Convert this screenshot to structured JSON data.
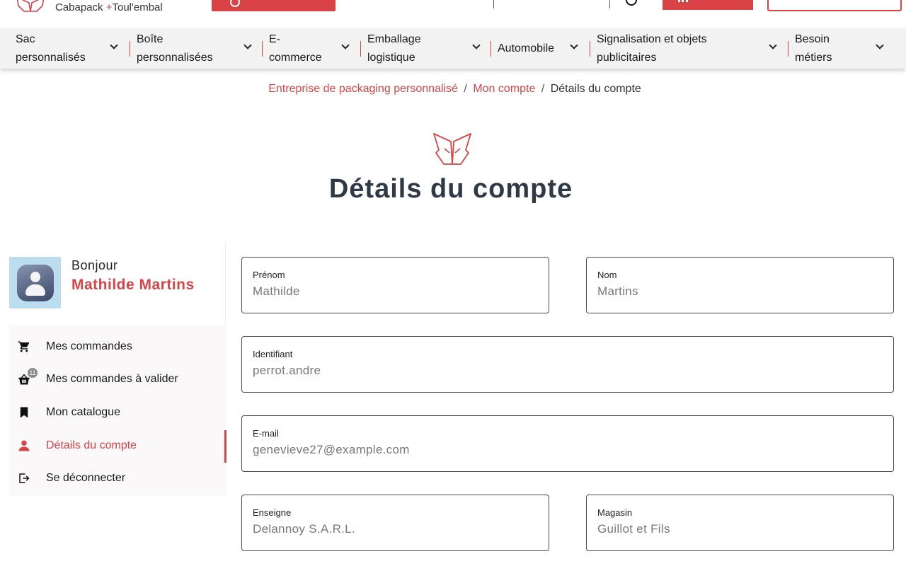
{
  "brand": {
    "line": "Cabapack",
    "plus": "+",
    "partner": "Toul'embal"
  },
  "categories": [
    {
      "label": "Sac personnalisés"
    },
    {
      "label": "Boîte personnalisées"
    },
    {
      "label": "E-commerce"
    },
    {
      "label": "Emballage logistique"
    },
    {
      "label": "Automobile"
    },
    {
      "label": "Signalisation et objets publicitaires"
    },
    {
      "label": "Besoin métiers"
    }
  ],
  "breadcrumb": {
    "home": "Entreprise de packaging personnalisé",
    "separator": "/",
    "account": "Mon compte",
    "current": "Détails du compte"
  },
  "page": {
    "title": "Détails du compte"
  },
  "user": {
    "greeting": "Bonjour",
    "name": "Mathilde Martins"
  },
  "menu": [
    {
      "label": "Mes commandes",
      "icon": "cart-icon"
    },
    {
      "label": "Mes commandes à valider",
      "icon": "basket-icon",
      "badge": "11"
    },
    {
      "label": "Mon catalogue",
      "icon": "bookmark-icon"
    },
    {
      "label": "Détails du compte",
      "icon": "user-icon",
      "active": true
    },
    {
      "label": "Se déconnecter",
      "icon": "logout-icon"
    }
  ],
  "form": {
    "prenom": {
      "label": "Prénom",
      "value": "Mathilde"
    },
    "nom": {
      "label": "Nom",
      "value": "Martins"
    },
    "identifiant": {
      "label": "Identifiant",
      "value": "perrot.andre"
    },
    "email": {
      "label": "E-mail",
      "value": "genevieve27@example.com"
    },
    "enseigne": {
      "label": "Enseigne",
      "value": "Delannoy S.A.R.L."
    },
    "magasin": {
      "label": "Magasin",
      "value": "Guillot et Fils"
    }
  },
  "colors": {
    "accent": "#d94346",
    "title": "#2f3a46",
    "nav_bg": "#f2f2f2"
  }
}
